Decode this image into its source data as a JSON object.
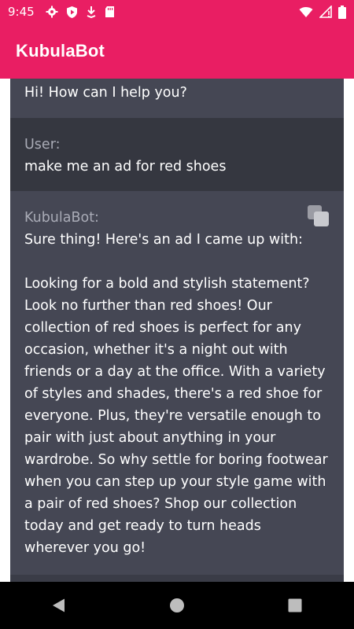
{
  "status_bar": {
    "time": "9:45",
    "icons_left": [
      "settings-icon",
      "shield-icon",
      "download-icon",
      "sd-card-icon"
    ],
    "icons_right": [
      "wifi-icon",
      "signal-icon",
      "battery-icon"
    ]
  },
  "app_bar": {
    "title": "KubulaBot"
  },
  "messages": [
    {
      "role": "bot",
      "sender": "",
      "text": "Hi! How can I help you?"
    },
    {
      "role": "user",
      "sender": "User:",
      "text": "make me an ad for red shoes"
    },
    {
      "role": "bot",
      "sender": "KubulaBot:",
      "text": "Sure thing! Here's an ad I came up with:\n\nLooking for a bold and stylish statement? Look no further than red shoes! Our collection of red shoes is perfect for any occasion, whether it's a night out with friends or a day at the office. With a variety of styles and shades, there's a red shoe for everyone. Plus, they're versatile enough to pair with just about anything in your wardrobe. So why settle for boring footwear when you can step up your style game with a pair of red shoes? Shop our collection today and get ready to turn heads wherever you go!",
      "copy_icon": "copy-icon"
    }
  ],
  "nav_bar": {
    "buttons": [
      "back-icon",
      "home-icon",
      "recents-icon"
    ]
  },
  "colors": {
    "accent": "#e91e63",
    "bot_bg": "#454754",
    "user_bg": "#353740",
    "sender_text": "#a9abb6"
  }
}
